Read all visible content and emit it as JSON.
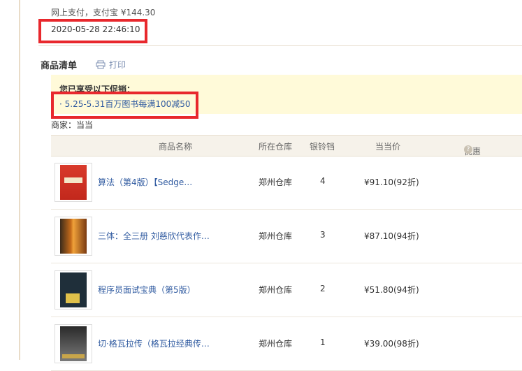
{
  "payment": {
    "text": "网上支付，支付宝 ¥144.30"
  },
  "order_time": "2020-05-28 22:46:10",
  "items_section": {
    "title": "商品清单",
    "print_label": "打印"
  },
  "promotion": {
    "title": "您已享受以下促销：",
    "item": "· 5.25-5.31百万图书每满100减50"
  },
  "seller": "商家：当当",
  "table": {
    "headers": {
      "name": "商品名称",
      "warehouse": "所在仓库",
      "points": "银铃铛",
      "price": "当当价",
      "discount": "优惠"
    },
    "rows": [
      {
        "title": "算法（第4版）【Sedge…",
        "warehouse": "郑州仓库",
        "points": "4",
        "price": "¥91.10(92折)"
      },
      {
        "title": "三体：全三册 刘慈欣代表作…",
        "warehouse": "郑州仓库",
        "points": "3",
        "price": "¥87.10(94折)"
      },
      {
        "title": "程序员面试宝典（第5版）",
        "warehouse": "郑州仓库",
        "points": "2",
        "price": "¥51.80(94折)"
      },
      {
        "title": "切·格瓦拉传（格瓦拉经典传…",
        "warehouse": "郑州仓库",
        "points": "1",
        "price": "¥39.00(98折)"
      }
    ]
  },
  "colors": {
    "highlight_box": "#e8282d",
    "link": "#2f5aa0",
    "promo_bg": "#fffad9"
  }
}
